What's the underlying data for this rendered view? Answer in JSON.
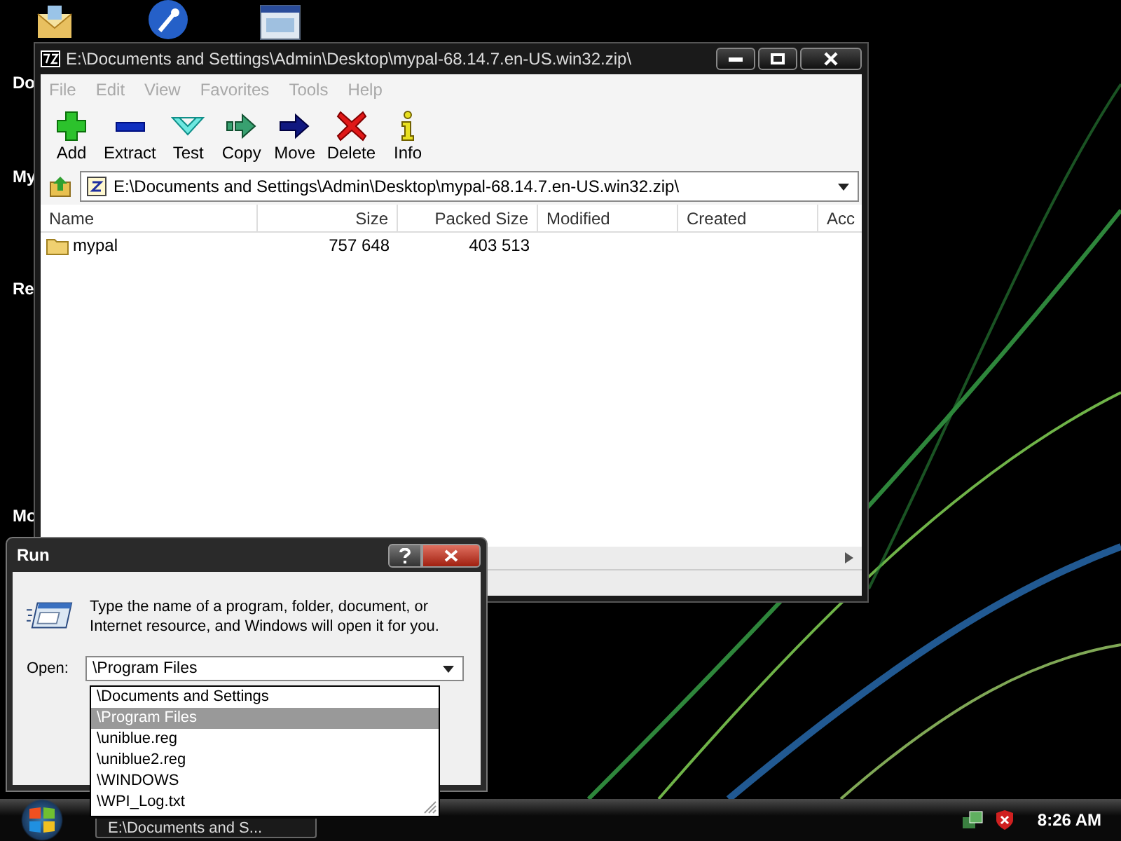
{
  "desktop": {
    "icon_labels": [
      "Do",
      "My",
      "Re",
      "Mo"
    ]
  },
  "archive_window": {
    "title": "E:\\Documents and Settings\\Admin\\Desktop\\mypal-68.14.7.en-US.win32.zip\\",
    "menu": [
      "File",
      "Edit",
      "View",
      "Favorites",
      "Tools",
      "Help"
    ],
    "toolbar": [
      {
        "label": "Add",
        "kind": "add"
      },
      {
        "label": "Extract",
        "kind": "extract"
      },
      {
        "label": "Test",
        "kind": "test"
      },
      {
        "label": "Copy",
        "kind": "copy"
      },
      {
        "label": "Move",
        "kind": "move"
      },
      {
        "label": "Delete",
        "kind": "delete"
      },
      {
        "label": "Info",
        "kind": "info"
      }
    ],
    "address": "E:\\Documents and Settings\\Admin\\Desktop\\mypal-68.14.7.en-US.win32.zip\\",
    "columns": [
      "Name",
      "Size",
      "Packed Size",
      "Modified",
      "Created",
      "Acc"
    ],
    "rows": [
      {
        "name": "mypal",
        "size": "757 648",
        "packed_size": "403 513"
      }
    ]
  },
  "run_dialog": {
    "title": "Run",
    "prompt": "Type the name of a program, folder, document, or Internet resource, and Windows will open it for you.",
    "open_label": "Open:",
    "value": "\\Program Files",
    "suggestions": [
      {
        "text": "\\Documents and Settings",
        "selected": false
      },
      {
        "text": "\\Program Files",
        "selected": true
      },
      {
        "text": "\\uniblue.reg",
        "selected": false
      },
      {
        "text": "\\uniblue2.reg",
        "selected": false
      },
      {
        "text": "\\WINDOWS",
        "selected": false
      },
      {
        "text": "\\WPI_Log.txt",
        "selected": false
      }
    ]
  },
  "taskbar": {
    "tasks": [
      "E:\\Documents and S..."
    ],
    "clock": "8:26 AM"
  }
}
